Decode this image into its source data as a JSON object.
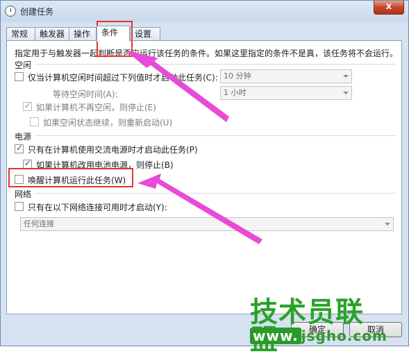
{
  "window": {
    "title": "创建任务",
    "close_label": "x"
  },
  "tabs": [
    {
      "label": "常规"
    },
    {
      "label": "触发器"
    },
    {
      "label": "操作"
    },
    {
      "label": "条件"
    },
    {
      "label": "设置"
    }
  ],
  "description": "指定用于与触发器一起判断是否应运行该任务的条件。如果这里指定的条件不是真，该任务将不会运行。",
  "idle": {
    "section_label": "空闲",
    "start_if_idle": "仅当计算机空闲时间超过下列值时才启动此任务(C):",
    "idle_duration": "10 分钟",
    "wait_label": "等待空闲时间(A):",
    "wait_duration": "1 小时",
    "stop_if_not_idle": "如果计算机不再空闲，则停止(E)",
    "restart_if_idle": "如果空闲状态继续，则重新启动(U)"
  },
  "power": {
    "section_label": "电源",
    "ac_only": "只有在计算机使用交流电源时才启动此任务(P)",
    "stop_on_battery": "如果计算机改用电池电源，则停止(B)",
    "wake": "唤醒计算机运行此任务(W)"
  },
  "network": {
    "section_label": "网络",
    "start_if_network": "只有在以下网络连接可用时才启动(Y):",
    "connection": "任何连接"
  },
  "buttons": {
    "ok": "确定",
    "cancel": "取消"
  },
  "watermark": {
    "title": "技术员联盟",
    "url_prefix": "www.",
    "url_rest": "jsgho.com"
  }
}
